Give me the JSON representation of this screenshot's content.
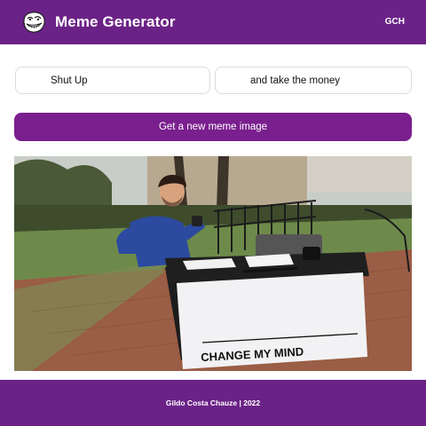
{
  "header": {
    "logo_icon": "trollface-icon",
    "title": "Meme Generator",
    "user_initials": "GCH"
  },
  "form": {
    "top_text": "Shut Up",
    "bottom_text": "and take the money",
    "button_label": "Get a new meme image"
  },
  "meme": {
    "sign_text": "CHANGE MY MIND"
  },
  "footer": {
    "text": "Gildo Costa Chauze | 2022"
  },
  "colors": {
    "brand": "#6b2287",
    "button": "#7a1f8e"
  }
}
